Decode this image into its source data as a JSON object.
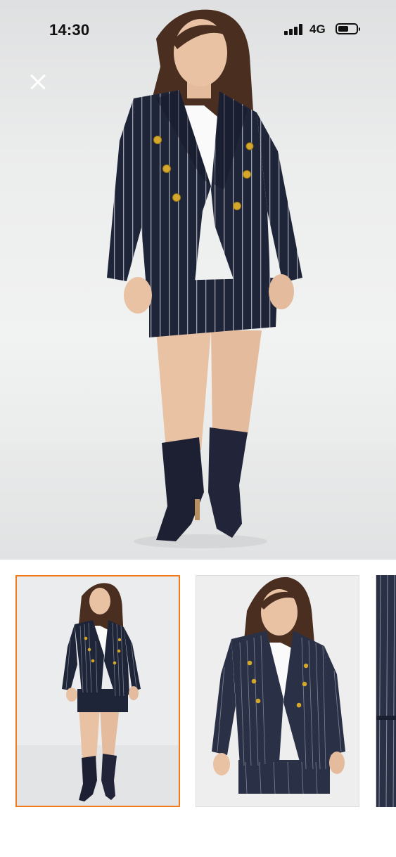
{
  "status_bar": {
    "time": "14:30",
    "network": "4G",
    "signal_bars": 4,
    "battery_level": 0.6
  },
  "close_button": {
    "icon": "close-icon"
  },
  "gallery": {
    "selected_index": 0,
    "accent_color": "#f27a1a",
    "thumbnails": [
      {
        "name": "thumbnail-1",
        "state": "selected"
      },
      {
        "name": "thumbnail-2",
        "state": "default"
      },
      {
        "name": "thumbnail-3",
        "state": "partially-visible"
      }
    ]
  },
  "colors": {
    "outfit_navy": "#1f2538",
    "pinstripe": "#c9cbd4",
    "button_gold": "#d4a82c",
    "shirt": "#fafafa",
    "hair": "#4a2e20",
    "skin": "#e9c2a4"
  }
}
